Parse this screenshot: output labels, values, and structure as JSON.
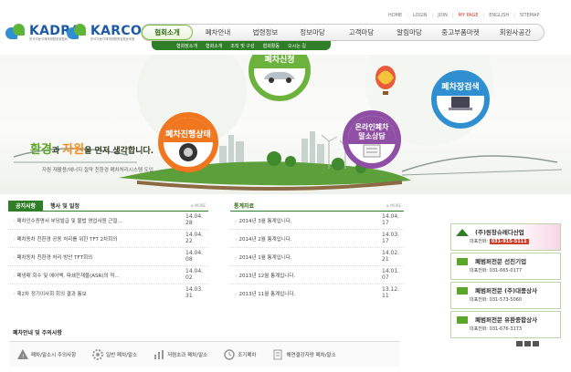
{
  "logos": [
    {
      "name": "KADRA",
      "subtitle": "한국자동차해체재활용업협회"
    },
    {
      "name": "KARCO",
      "subtitle": "한국자동차해체재활용업협동조합"
    }
  ],
  "top_menu": [
    "HOME",
    "LOGIN",
    "JOIN",
    "MY PAGE",
    "ENGLISH",
    "SITEMAP"
  ],
  "gnb": [
    "협회소개",
    "폐차안내",
    "법령정보",
    "정보마당",
    "고객마당",
    "알림마당",
    "중고부품마켓",
    "회원사공간"
  ],
  "sub_nav": [
    "협회장소개",
    "협회소개",
    "조직 및 구성",
    "협회활동",
    "오시는 길"
  ],
  "hero": {
    "tagline_parts": {
      "a": "환경",
      "b": "과 ",
      "c": "자원",
      "d": "을 먼저 생각합니다."
    },
    "description": "자원 재활용/에너지 절약 친환경 폐차처리시스템 도입",
    "bubbles": [
      "폐차신청",
      "폐차장검색",
      "폐차진행상태",
      "온라인폐차 말소상담"
    ]
  },
  "notice": {
    "tab_active": "공지사항",
    "tab_other": "행사 및 일정",
    "more": "MORE",
    "items": [
      {
        "title": "폐차인수증명서 부당발급 및 불법 영업사원 근절...",
        "date": "14.04.28"
      },
      {
        "title": "폐차동차 친환경 공동 처리를 위한 TFT 2차회의",
        "date": "14.04.22"
      },
      {
        "title": "폐차동차 친환경 처리 방안 TFT회의",
        "date": "14.04.08"
      },
      {
        "title": "폐냉매 회수 및 에어백,   파쇄잔재물(ASR)의 적...",
        "date": "14.04.02"
      },
      {
        "title": "제2차 정기이사회 회의 결과 통보",
        "date": "14.03.31"
      }
    ]
  },
  "stats": {
    "title": "통계자료",
    "more": "MORE",
    "items": [
      {
        "title": "2014년 3월 통계입니다.",
        "date": "14.04.17"
      },
      {
        "title": "2014년 2월 통계입니다.",
        "date": "14.03.17"
      },
      {
        "title": "2014년 1월 통계입니다.",
        "date": "14.02.21"
      },
      {
        "title": "2013년 12월 통계입니다.",
        "date": "14.01.07"
      },
      {
        "title": "2013년 11월 통계입니다.",
        "date": "13.12.11"
      }
    ]
  },
  "ads": [
    {
      "name": "(주)원창슈레다산업",
      "tel_label": "대표전화:",
      "tel": "031-915-5111",
      "tel_highlight": true
    },
    {
      "name": "폐범퍼전문 선진기업",
      "tel_label": "대표전화:",
      "tel": "031-665-0177",
      "tel_highlight": false
    },
    {
      "name": "폐범퍼전문 (주)대풍상사",
      "tel_label": "대표전화:",
      "tel": "031-573-5060",
      "tel_highlight": false
    },
    {
      "name": "폐범퍼전문 유환종합상사",
      "tel_label": "대표전화:",
      "tel": "031-676-3173",
      "tel_highlight": false
    }
  ],
  "bottom": {
    "title": "폐차안내 및 주의사항",
    "items": [
      {
        "label": "폐차/말소시 주의사항",
        "icon": "warning-icon",
        "color": "#888888"
      },
      {
        "label": "일반 폐차/말소",
        "icon": "gear-icon",
        "color": "#999999"
      },
      {
        "label": "저렴초과 폐차/말소",
        "icon": "chart-icon",
        "color": "#999999"
      },
      {
        "label": "조기폐차",
        "icon": "alarm-icon",
        "color": "#999999"
      },
      {
        "label": "해연결강자량 폐차/말소",
        "icon": "document-icon",
        "color": "#999999"
      }
    ]
  },
  "colors": {
    "brand_green": "#2f7d26",
    "accent_orange": "#f28a1e",
    "link_red": "#d73a20"
  }
}
